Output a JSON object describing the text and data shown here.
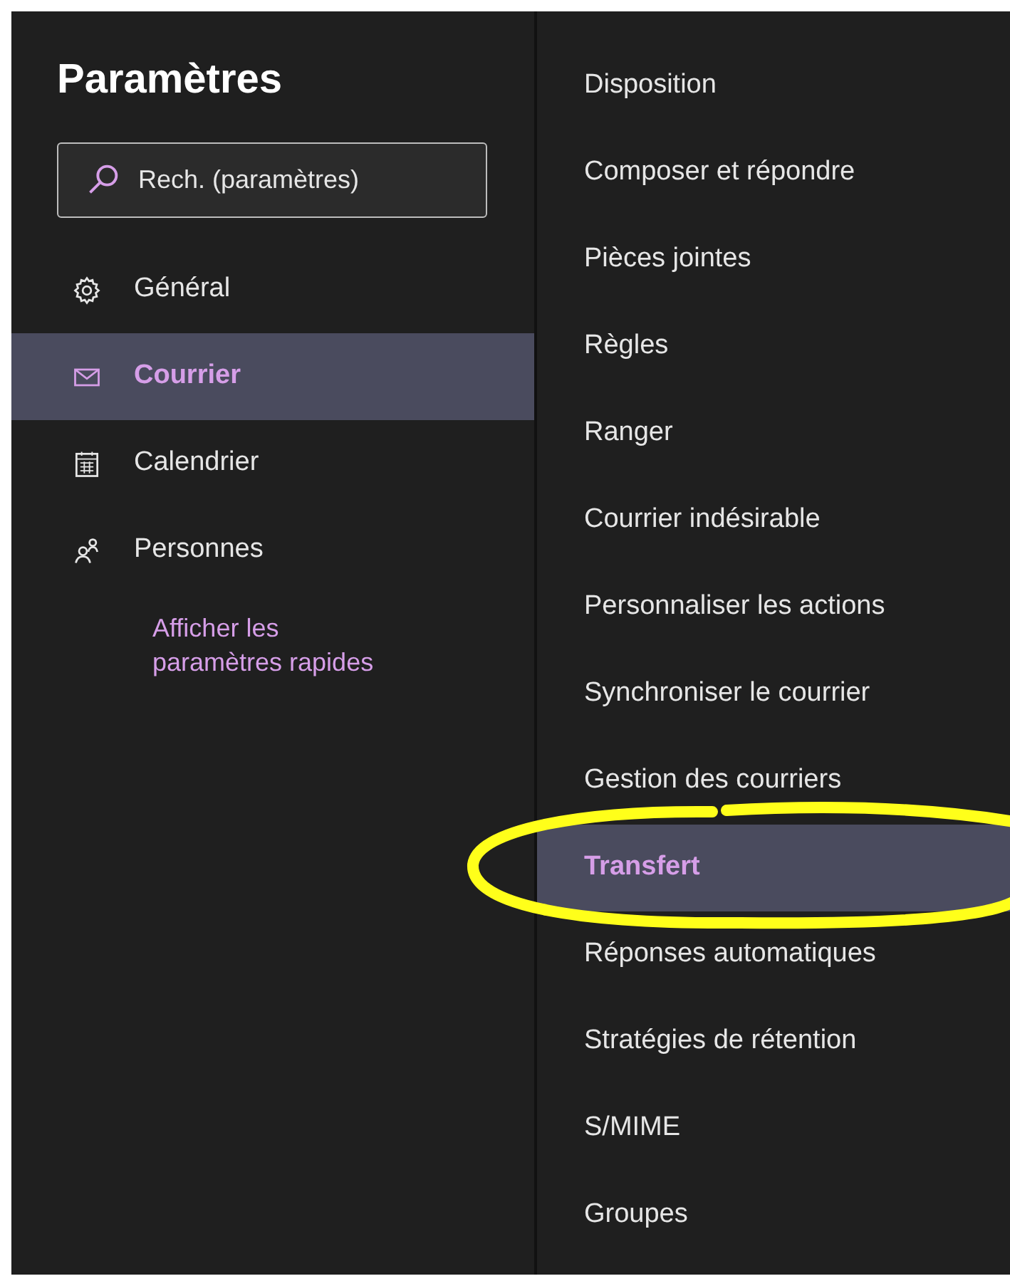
{
  "title": "Paramètres",
  "search": {
    "placeholder": "Rech. (paramètres)"
  },
  "nav": [
    {
      "label": "Général",
      "kind": "gear",
      "selected": false
    },
    {
      "label": "Courrier",
      "kind": "mail",
      "selected": true
    },
    {
      "label": "Calendrier",
      "kind": "calendar",
      "selected": false
    },
    {
      "label": "Personnes",
      "kind": "people",
      "selected": false
    }
  ],
  "quick_settings_link": "Afficher les paramètres rapides",
  "mail_settings": [
    {
      "label": "Disposition",
      "selected": false
    },
    {
      "label": "Composer et répondre",
      "selected": false
    },
    {
      "label": "Pièces jointes",
      "selected": false
    },
    {
      "label": "Règles",
      "selected": false
    },
    {
      "label": "Ranger",
      "selected": false
    },
    {
      "label": "Courrier indésirable",
      "selected": false
    },
    {
      "label": "Personnaliser les actions",
      "selected": false
    },
    {
      "label": "Synchroniser le courrier",
      "selected": false
    },
    {
      "label": "Gestion des courriers",
      "selected": false
    },
    {
      "label": "Transfert",
      "selected": true
    },
    {
      "label": "Réponses automatiques",
      "selected": false
    },
    {
      "label": "Stratégies de rétention",
      "selected": false
    },
    {
      "label": "S/MIME",
      "selected": false
    },
    {
      "label": "Groupes",
      "selected": false
    }
  ]
}
